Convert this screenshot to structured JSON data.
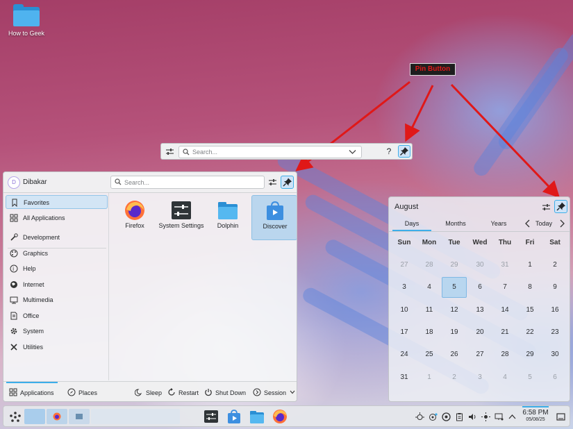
{
  "desktop": {
    "icon_label": "How to Geek"
  },
  "annotation": {
    "label": "Pin Button",
    "color": "#e01818"
  },
  "krunner": {
    "search_placeholder": "Search...",
    "help_label": "?",
    "icons": [
      "configure-icon",
      "search-icon",
      "chevron-down-icon",
      "pin-icon"
    ]
  },
  "kickoff": {
    "username": "Dibakar",
    "avatar_initial": "D",
    "search_placeholder": "Search...",
    "categories": [
      {
        "label": "Favorites",
        "icon": "bookmark-icon",
        "selected": true
      },
      {
        "label": "All Applications",
        "icon": "grid-icon"
      },
      {
        "label": "Development",
        "icon": "wrench-icon"
      },
      {
        "label": "Graphics",
        "icon": "palette-icon"
      },
      {
        "label": "Help",
        "icon": "help-icon"
      },
      {
        "label": "Internet",
        "icon": "globe-icon"
      },
      {
        "label": "Multimedia",
        "icon": "monitor-icon"
      },
      {
        "label": "Office",
        "icon": "document-icon"
      },
      {
        "label": "System",
        "icon": "gear-icon"
      },
      {
        "label": "Utilities",
        "icon": "tools-icon"
      }
    ],
    "apps": [
      {
        "name": "Firefox",
        "icon": "firefox-icon"
      },
      {
        "name": "System Settings",
        "icon": "system-settings-icon"
      },
      {
        "name": "Dolphin",
        "icon": "dolphin-folder-icon"
      },
      {
        "name": "Discover",
        "icon": "discover-bag-icon",
        "selected": true
      }
    ],
    "footer": {
      "applications": "Applications",
      "places": "Places",
      "sleep": "Sleep",
      "restart": "Restart",
      "shutdown": "Shut Down",
      "session": "Session"
    }
  },
  "calendar": {
    "month": "August",
    "tabs": [
      "Days",
      "Months",
      "Years"
    ],
    "active_tab": "Days",
    "today_label": "Today",
    "weekdays": [
      "Sun",
      "Mon",
      "Tue",
      "Wed",
      "Thu",
      "Fri",
      "Sat"
    ],
    "weeks": [
      [
        "27",
        "28",
        "29",
        "30",
        "31",
        "1",
        "2"
      ],
      [
        "3",
        "4",
        "5",
        "6",
        "7",
        "8",
        "9"
      ],
      [
        "10",
        "11",
        "12",
        "13",
        "14",
        "15",
        "16"
      ],
      [
        "17",
        "18",
        "19",
        "20",
        "21",
        "22",
        "23"
      ],
      [
        "24",
        "25",
        "26",
        "27",
        "28",
        "29",
        "30"
      ],
      [
        "31",
        "1",
        "2",
        "3",
        "4",
        "5",
        "6"
      ]
    ],
    "selected_day": "5"
  },
  "taskbar": {
    "clock_time": "6:58 PM",
    "clock_date": "05/08/25",
    "tasks": [
      "system-settings-icon",
      "discover-icon",
      "dolphin-icon",
      "firefox-icon"
    ],
    "tray": [
      "sun-bug-icon",
      "vault-icon",
      "sync-icon",
      "clipboard-icon",
      "volume-icon",
      "brightness-icon",
      "display-icon",
      "chevron-up-icon"
    ]
  }
}
